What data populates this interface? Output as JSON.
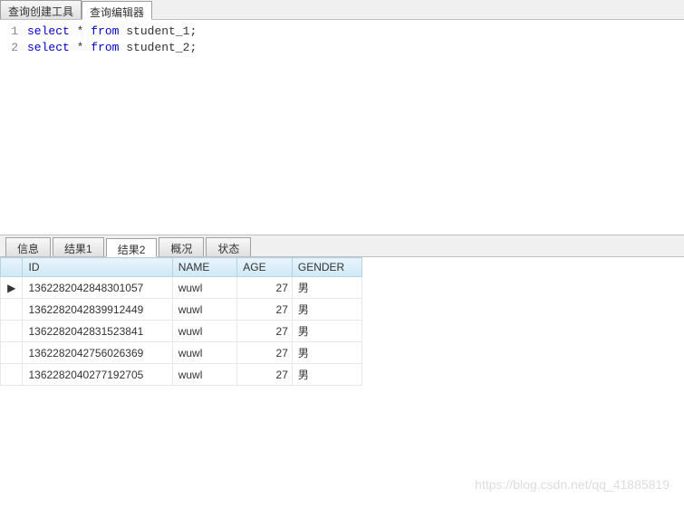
{
  "topTabs": {
    "items": [
      {
        "label": "查询创建工具",
        "active": false
      },
      {
        "label": "查询编辑器",
        "active": true
      }
    ]
  },
  "editor": {
    "lines": [
      {
        "num": "1",
        "tokens": [
          {
            "t": "select",
            "c": "kw"
          },
          {
            "t": " * ",
            "c": "ident"
          },
          {
            "t": "from",
            "c": "kw"
          },
          {
            "t": " student_1;",
            "c": "ident"
          }
        ]
      },
      {
        "num": "2",
        "tokens": [
          {
            "t": "select",
            "c": "kw"
          },
          {
            "t": " * ",
            "c": "ident"
          },
          {
            "t": "from",
            "c": "kw"
          },
          {
            "t": " student_2;",
            "c": "ident"
          }
        ]
      }
    ]
  },
  "bottomTabs": {
    "items": [
      {
        "label": "信息",
        "active": false
      },
      {
        "label": "结果1",
        "active": false
      },
      {
        "label": "结果2",
        "active": true
      },
      {
        "label": "概况",
        "active": false
      },
      {
        "label": "状态",
        "active": false
      }
    ]
  },
  "table": {
    "columns": [
      "ID",
      "NAME",
      "AGE",
      "GENDER"
    ],
    "rows": [
      {
        "current": true,
        "ID": "1362282042848301057",
        "NAME": "wuwl",
        "AGE": "27",
        "GENDER": "男"
      },
      {
        "current": false,
        "ID": "1362282042839912449",
        "NAME": "wuwl",
        "AGE": "27",
        "GENDER": "男"
      },
      {
        "current": false,
        "ID": "1362282042831523841",
        "NAME": "wuwl",
        "AGE": "27",
        "GENDER": "男"
      },
      {
        "current": false,
        "ID": "1362282042756026369",
        "NAME": "wuwl",
        "AGE": "27",
        "GENDER": "男"
      },
      {
        "current": false,
        "ID": "1362282040277192705",
        "NAME": "wuwl",
        "AGE": "27",
        "GENDER": "男"
      }
    ]
  },
  "watermark": "https://blog.csdn.net/qq_41885819"
}
